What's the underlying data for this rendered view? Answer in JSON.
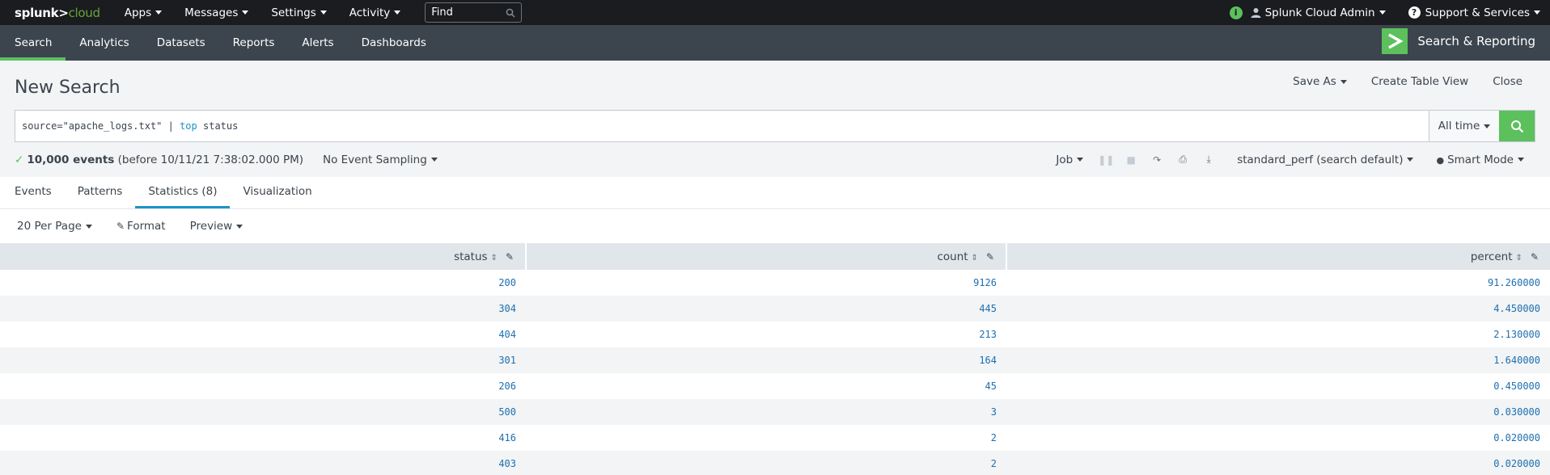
{
  "topbar": {
    "logo_part1": "splunk>",
    "logo_part2": "cloud",
    "menus": [
      "Apps",
      "Messages",
      "Settings",
      "Activity"
    ],
    "find_placeholder": "Find",
    "user": "Splunk Cloud Admin",
    "support": "Support & Services"
  },
  "appnav": {
    "tabs": [
      "Search",
      "Analytics",
      "Datasets",
      "Reports",
      "Alerts",
      "Dashboards"
    ],
    "active_tab": "Search",
    "app_name": "Search & Reporting"
  },
  "titlebar": {
    "title": "New Search",
    "save_as": "Save As",
    "create_table_view": "Create Table View",
    "close": "Close"
  },
  "search": {
    "query_prefix": "source=\"apache_logs.txt\" | ",
    "query_keyword": "top",
    "query_suffix": " status",
    "time_range": "All time"
  },
  "status": {
    "events_count": "10,000 events",
    "events_detail": "(before 10/11/21 7:38:02.000 PM)",
    "sampling": "No Event Sampling",
    "job": "Job",
    "perf": "standard_perf (search default)",
    "mode": "Smart Mode"
  },
  "results_tabs": [
    "Events",
    "Patterns",
    "Statistics (8)",
    "Visualization"
  ],
  "options": {
    "per_page": "20 Per Page",
    "format": "Format",
    "preview": "Preview"
  },
  "table": {
    "columns": [
      "status",
      "count",
      "percent"
    ],
    "rows": [
      [
        "200",
        "9126",
        "91.260000"
      ],
      [
        "304",
        "445",
        "4.450000"
      ],
      [
        "404",
        "213",
        "2.130000"
      ],
      [
        "301",
        "164",
        "1.640000"
      ],
      [
        "206",
        "45",
        "0.450000"
      ],
      [
        "500",
        "3",
        "0.030000"
      ],
      [
        "416",
        "2",
        "0.020000"
      ],
      [
        "403",
        "2",
        "0.020000"
      ]
    ]
  },
  "colors": {
    "accent_green": "#5cc05c",
    "link_blue": "#1e93c6",
    "topbar_bg": "#1a1c20",
    "appnav_bg": "#3c444d"
  }
}
